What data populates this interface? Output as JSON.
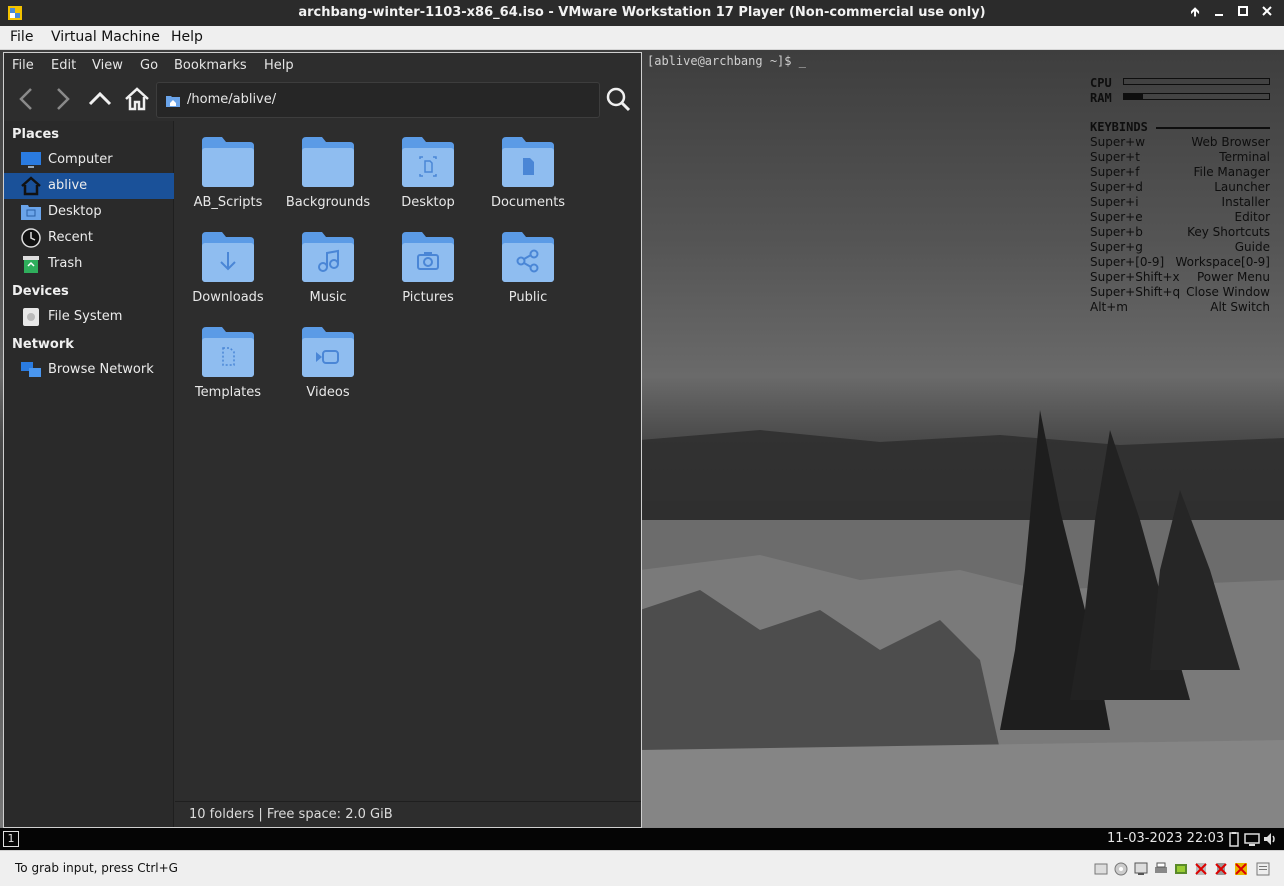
{
  "host": {
    "title": "archbang-winter-1103-x86_64.iso - VMware Workstation 17 Player (Non-commercial use only)",
    "menu": [
      "File",
      "Virtual Machine",
      "Help"
    ],
    "status_message": "To grab input, press Ctrl+G"
  },
  "file_manager": {
    "menu": [
      "File",
      "Edit",
      "View",
      "Go",
      "Bookmarks",
      "Help"
    ],
    "location": "/home/ablive/",
    "sidebar": {
      "places_heading": "Places",
      "places": [
        "Computer",
        "ablive",
        "Desktop",
        "Recent",
        "Trash"
      ],
      "devices_heading": "Devices",
      "devices": [
        "File System"
      ],
      "network_heading": "Network",
      "network": [
        "Browse Network"
      ]
    },
    "folders": [
      "AB_Scripts",
      "Backgrounds",
      "Desktop",
      "Documents",
      "Downloads",
      "Music",
      "Pictures",
      "Public",
      "Templates",
      "Videos"
    ],
    "status": "10 folders  |  Free space: 2.0 GiB"
  },
  "terminal": {
    "prompt": "[ablive@archbang ~]$ _"
  },
  "conky": {
    "cpu_label": "CPU",
    "cpu_level": 0.0,
    "ram_label": "RAM",
    "ram_level": 0.13,
    "keybinds_heading": "KEYBINDS",
    "keybinds": [
      {
        "key": "Super+w",
        "action": "Web Browser"
      },
      {
        "key": "Super+t",
        "action": "Terminal"
      },
      {
        "key": "Super+f",
        "action": "File Manager"
      },
      {
        "key": "Super+d",
        "action": "Launcher"
      },
      {
        "key": "Super+i",
        "action": "Installer"
      },
      {
        "key": "Super+e",
        "action": "Editor"
      },
      {
        "key": "Super+b",
        "action": "Key Shortcuts"
      },
      {
        "key": "Super+g",
        "action": "Guide"
      },
      {
        "key": "Super+[0-9]",
        "action": "Workspace[0-9]"
      },
      {
        "key": "Super+Shift+x",
        "action": "Power Menu"
      },
      {
        "key": "Super+Shift+q",
        "action": "Close Window"
      },
      {
        "key": "Alt+m",
        "action": "Alt Switch"
      }
    ]
  },
  "panel": {
    "workspace": "1",
    "clock": "11-03-2023 22:03"
  },
  "colors": {
    "folder": "#8fbdf0",
    "folder_tab": "#5b9be6",
    "selection": "#1a5199"
  }
}
